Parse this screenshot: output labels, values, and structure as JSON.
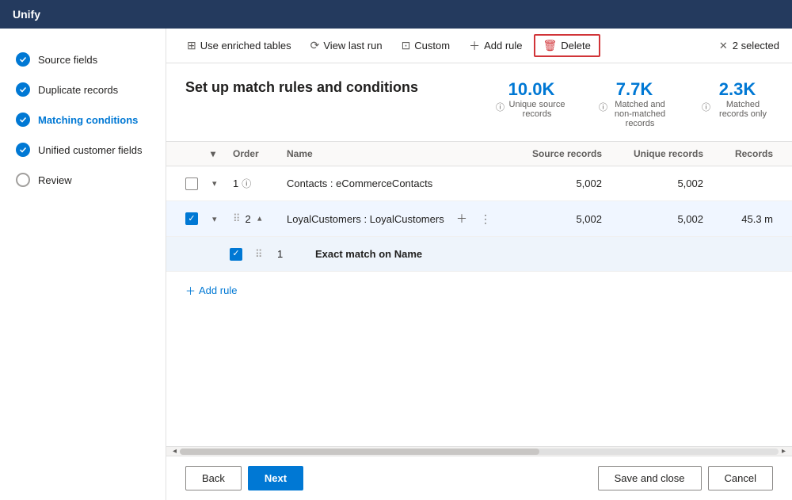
{
  "app": {
    "title": "Unify"
  },
  "sidebar": {
    "items": [
      {
        "id": "source-fields",
        "label": "Source fields",
        "checked": true,
        "active": false
      },
      {
        "id": "duplicate-records",
        "label": "Duplicate records",
        "checked": true,
        "active": false
      },
      {
        "id": "matching-conditions",
        "label": "Matching conditions",
        "checked": true,
        "active": true
      },
      {
        "id": "unified-customer-fields",
        "label": "Unified customer fields",
        "checked": true,
        "active": false
      },
      {
        "id": "review",
        "label": "Review",
        "checked": false,
        "active": false
      }
    ]
  },
  "toolbar": {
    "use_enriched_label": "Use enriched tables",
    "view_last_run_label": "View last run",
    "custom_label": "Custom",
    "add_rule_label": "Add rule",
    "delete_label": "Delete",
    "selected_count": "2 selected"
  },
  "content": {
    "title": "Set up match rules and conditions",
    "stats": [
      {
        "id": "unique-source",
        "value": "10.0K",
        "label": "Unique source records"
      },
      {
        "id": "matched-non-matched",
        "value": "7.7K",
        "label": "Matched and non-matched records"
      },
      {
        "id": "matched-only",
        "value": "2.3K",
        "label": "Matched records only"
      }
    ]
  },
  "table": {
    "headers": {
      "order": "Order",
      "name": "Name",
      "source_records": "Source records",
      "unique_records": "Unique records",
      "records": "Records"
    },
    "rows": [
      {
        "id": "row-contacts",
        "checked": false,
        "order": "1",
        "name": "Contacts : eCommerceContacts",
        "source_records": "5,002",
        "unique_records": "5,002",
        "records": "",
        "sub_rows": []
      },
      {
        "id": "row-loyal",
        "checked": true,
        "order": "2",
        "name": "LoyalCustomers : LoyalCustomers",
        "source_records": "5,002",
        "unique_records": "5,002",
        "records": "45.3 m",
        "sub_rows": [
          {
            "id": "sub-row-exact",
            "checked": true,
            "order": "1",
            "name": "Exact match on Name"
          }
        ]
      }
    ],
    "add_rule_label": "+ Add rule"
  },
  "footer": {
    "back_label": "Back",
    "next_label": "Next",
    "save_close_label": "Save and close",
    "cancel_label": "Cancel"
  }
}
